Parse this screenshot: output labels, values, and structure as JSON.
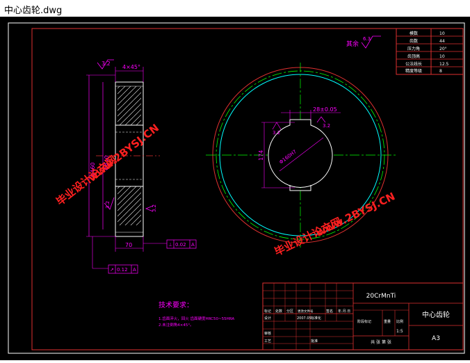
{
  "window": {
    "title": "中心齿轮.dwg"
  },
  "colors": {
    "background": "#000000",
    "frame": "#e03030",
    "dimension": "#ff00ff",
    "centerline": "#00ff00",
    "pitch_circle": "#00ffff",
    "text": "#ffffff",
    "watermark": "#ff2020"
  },
  "params_table": {
    "rows": [
      {
        "label": "模数",
        "value": "10"
      },
      {
        "label": "齿数",
        "value": "44"
      },
      {
        "label": "压力角",
        "value": "20°"
      },
      {
        "label": "齿顶高",
        "value": "10"
      },
      {
        "label": "公法线长",
        "value": "12.5"
      },
      {
        "label": "精度等级",
        "value": "8"
      }
    ]
  },
  "roughness": {
    "label": "其余",
    "value": "6.3"
  },
  "side_view": {
    "dim_top_roughness": "3.2",
    "dim_chamfer": "4×45°",
    "dim_outer_dia": "Φ460",
    "dim_inner_dia": "Φ440",
    "dim_mid_roughness": "3.2",
    "dim_right_roughness": "3.2",
    "dim_width": "70",
    "tol_perp_symbol": "⊥",
    "tol_perp_value": "0.02",
    "tol_perp_datum": "A",
    "tol_runout_symbol": "↗",
    "tol_runout_value": "0.12",
    "tol_runout_datum": "A"
  },
  "front_view": {
    "dim_keyway": "28±0.05",
    "dim_keyway_roughness": "3.2",
    "dim_left_roughness": "3.2",
    "dim_height": "174",
    "dim_bore": "Φ160H7"
  },
  "watermarks": {
    "left": "毕业设计论文网",
    "left_url": "www.2BYSJ.CN",
    "right": "毕业设计论文网",
    "right_url": "www.2BYSJ.CN"
  },
  "tech_requirements": {
    "title": "技术要求：",
    "items": [
      "1.齿面淬火，回火 齿面硬度HRC50~55HRA",
      "2.未注倒角4×45°。"
    ]
  },
  "title_block": {
    "material": "20CrMnTi",
    "part_name": "中心齿轮",
    "sheet": "A3",
    "scale_label": "比例",
    "scale": "1:5",
    "weight_label": "重量",
    "stage_label": "阶段标记",
    "sheets_label": "共 张 第 张",
    "row_mark": [
      "标记",
      "处数",
      "分区",
      "更改文件号",
      "签名",
      "年.月.日"
    ],
    "designer": "设计",
    "design_sign": "标准化",
    "date": "2007.05",
    "review": "审核",
    "process": "工艺",
    "approve": "批准"
  }
}
